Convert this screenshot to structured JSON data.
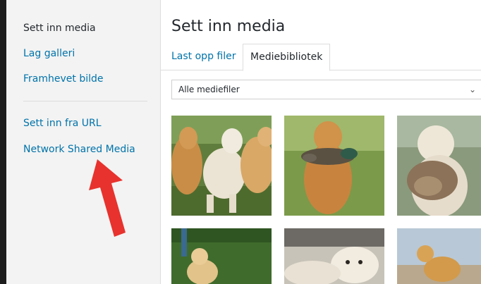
{
  "sidebar": {
    "items": [
      {
        "label": "Sett inn media",
        "current": true
      },
      {
        "label": "Lag galleri"
      },
      {
        "label": "Framhevet bilde"
      },
      {
        "label": "Sett inn fra URL"
      },
      {
        "label": "Network Shared Media"
      }
    ]
  },
  "main": {
    "title": "Sett inn media",
    "tabs": [
      {
        "label": "Last opp filer"
      },
      {
        "label": "Mediebibliotek",
        "active": true
      }
    ],
    "filter": {
      "selected": "Alle mediefiler"
    }
  },
  "colors": {
    "link": "#0073aa",
    "text": "#23282d",
    "arrow": "#e8322d"
  },
  "media_items": [
    {
      "icon": "golden-retrievers-group-photo"
    },
    {
      "icon": "golden-retriever-with-duck-photo"
    },
    {
      "icon": "white-retriever-with-bird-photo"
    },
    {
      "icon": "golden-retriever-show-photo"
    },
    {
      "icon": "white-retriever-lying-photo"
    },
    {
      "icon": "labrador-beach-photo"
    }
  ]
}
